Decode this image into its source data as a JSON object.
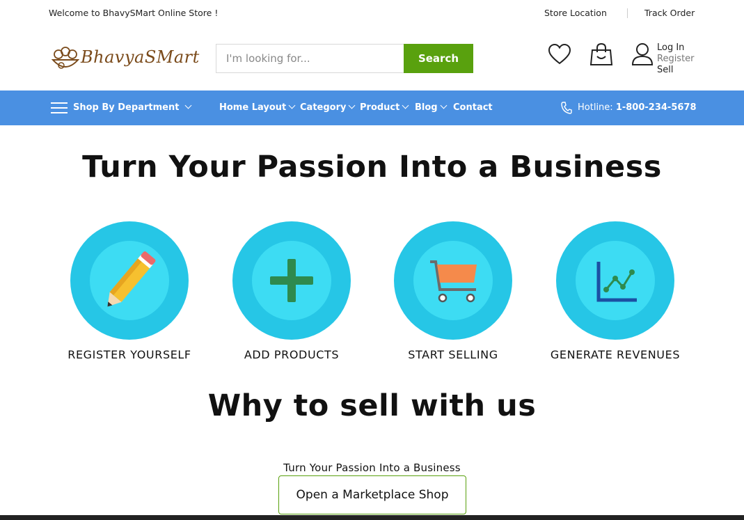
{
  "topbar": {
    "welcome": "Welcome to BhavySMart Online Store !",
    "store_location": "Store Location",
    "track_order": "Track Order"
  },
  "header": {
    "logo_text": "BhavyaSMart",
    "search_placeholder": "I'm looking for...",
    "search_button": "Search",
    "account": {
      "login": "Log In",
      "register": "Register",
      "sell": "Sell"
    },
    "icons": [
      "heart-icon",
      "shopping-bag-icon",
      "user-icon"
    ]
  },
  "nav": {
    "department": "Shop By Department",
    "items": [
      {
        "label": "Home Layout",
        "dropdown": true
      },
      {
        "label": "Category",
        "dropdown": true
      },
      {
        "label": "Product",
        "dropdown": true
      },
      {
        "label": "Blog",
        "dropdown": true
      },
      {
        "label": "Contact",
        "dropdown": false
      }
    ],
    "hotline_label": "Hotline:",
    "hotline_number": "1-800-234-5678"
  },
  "hero": {
    "title": "Turn Your Passion Into a Business",
    "steps": [
      {
        "label": "REGISTER YOURSELF",
        "icon": "pencil-icon"
      },
      {
        "label": "ADD PRODUCTS",
        "icon": "plus-icon"
      },
      {
        "label": "START SELLING",
        "icon": "cart-icon"
      },
      {
        "label": "GENERATE REVENUES",
        "icon": "chart-icon"
      }
    ],
    "why_title": "Why to sell with us",
    "subtitle": "Turn Your Passion Into a Business",
    "cta": "Open a Marketplace Shop"
  },
  "colors": {
    "nav_bg": "#4a90e2",
    "search_btn": "#59a10e",
    "circle_outer": "#26c6e6",
    "circle_inner": "#3ddcf3"
  }
}
